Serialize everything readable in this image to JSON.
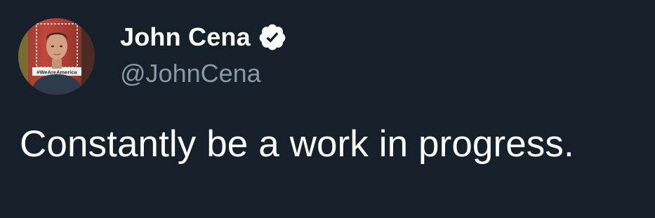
{
  "colors": {
    "background": "#15202b",
    "name": "#ffffff",
    "handle": "#8899a6",
    "tweet_text": "#ffffff",
    "verified_badge": "#ffffff"
  },
  "author": {
    "display_name": "John Cena",
    "handle": "@JohnCena",
    "verified_icon": "verified-badge-icon",
    "avatar_banner_text": "#WeAreAmerica"
  },
  "tweet": {
    "text": "Constantly be a work in progress."
  }
}
